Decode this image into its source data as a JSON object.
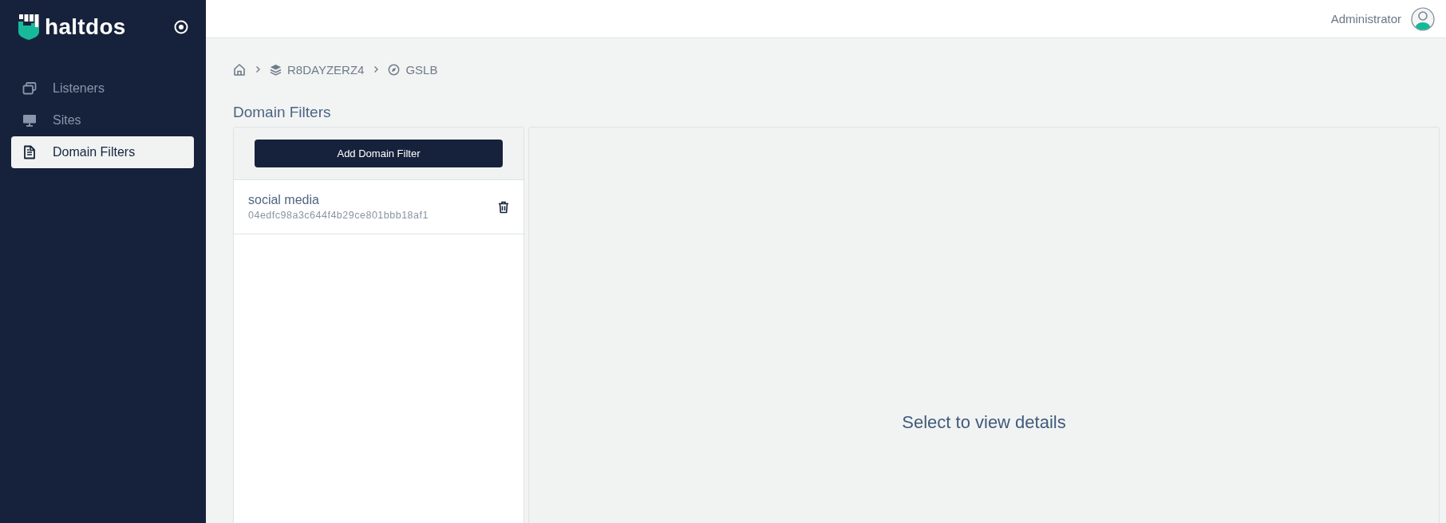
{
  "sidebar": {
    "brand": "haltdos",
    "items": [
      {
        "label": "Listeners",
        "selected": false
      },
      {
        "label": "Sites",
        "selected": false
      },
      {
        "label": "Domain Filters",
        "selected": true
      }
    ]
  },
  "header": {
    "user": "Administrator"
  },
  "breadcrumb": [
    {
      "label": "R8DAYZERZ4"
    },
    {
      "label": "GSLB"
    }
  ],
  "page_title": "Domain Filters",
  "filter_list": {
    "add_button": "Add Domain Filter",
    "items": [
      {
        "name": "social media",
        "id": "04edfc98a3c644f4b29ce801bbb18af1"
      }
    ]
  },
  "details": {
    "empty_message": "Select to view details"
  }
}
